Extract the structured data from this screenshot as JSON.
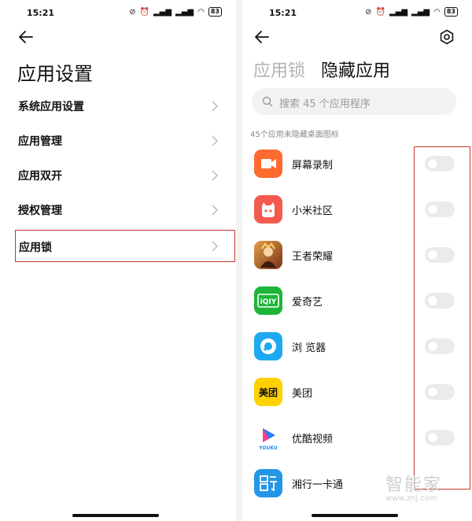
{
  "left": {
    "status": {
      "time": "15:21",
      "battery": "83"
    },
    "title": "应用设置",
    "menu_items": [
      {
        "label": "系统应用设置"
      },
      {
        "label": "应用管理"
      },
      {
        "label": "应用双开"
      },
      {
        "label": "授权管理"
      },
      {
        "label": "应用锁",
        "highlighted": true
      }
    ]
  },
  "right": {
    "status": {
      "time": "15:21",
      "battery": "83"
    },
    "tabs": [
      {
        "label": "应用锁",
        "active": false
      },
      {
        "label": "隐藏应用",
        "active": true
      }
    ],
    "search": {
      "placeholder": "搜索 45 个应用程序"
    },
    "caption": "45个应用未隐藏桌面图标",
    "apps": [
      {
        "name": "屏幕录制",
        "icon": "screen-record-icon",
        "color": "#ff6a2f",
        "hidden": false
      },
      {
        "name": "小米社区",
        "icon": "mi-community-icon",
        "color": "#f25b4e",
        "hidden": false
      },
      {
        "name": "王者荣耀",
        "icon": "honor-of-kings-icon",
        "color": "#9a4b24",
        "hidden": false
      },
      {
        "name": "爱奇艺",
        "icon": "iqiyi-icon",
        "color": "#1eb53a",
        "icon_text": "iQIY",
        "hidden": false
      },
      {
        "name": "浏 览器",
        "icon": "browser-icon",
        "color": "#1da9f0",
        "hidden": false
      },
      {
        "name": "美团",
        "icon": "meituan-icon",
        "color": "#ffd100",
        "icon_text": "美团",
        "hidden": false
      },
      {
        "name": "优酷视频",
        "icon": "youku-icon",
        "color": "#1d8cf0",
        "icon_text": "YOUKU",
        "hidden": false
      },
      {
        "name": "湘行一卡通",
        "icon": "xiangxing-card-icon",
        "color": "#2496e6",
        "hidden": false
      }
    ]
  },
  "watermark": {
    "text": "智能家",
    "url": "www.znj.com"
  }
}
